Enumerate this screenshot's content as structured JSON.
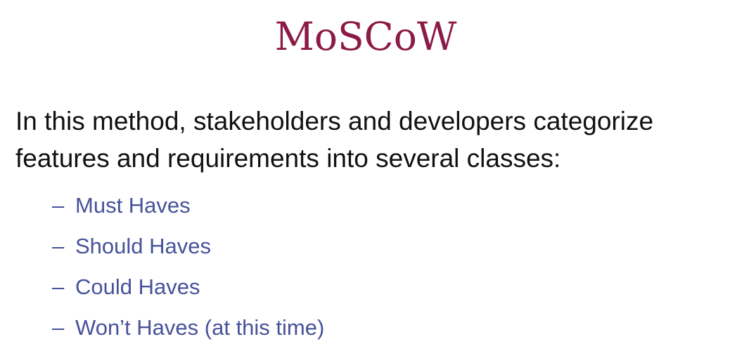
{
  "slide": {
    "title": "MoSCoW",
    "body": "In this method, stakeholders and developers categorize features and requirements into  several classes:",
    "bullet_marker": "–",
    "bullets": [
      "Must Haves",
      "Should Haves",
      "Could Haves",
      "Won’t Haves (at this time)"
    ]
  },
  "colors": {
    "title": "#8b1a46",
    "body": "#111111",
    "bullets": "#47529a"
  }
}
